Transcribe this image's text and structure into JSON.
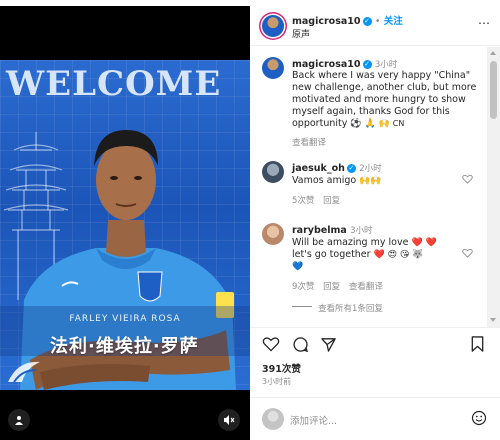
{
  "post": {
    "username": "magicrosa10",
    "follow_label": "关注",
    "audio_label": "原声",
    "separator": "•"
  },
  "media": {
    "banner_text": "WELCOME",
    "player_name": "FARLEY VIEIRA ROSA",
    "player_name_cn": "法利·维埃拉·罗萨",
    "user_icon": "person-icon",
    "mute_icon": "muted-speaker-icon"
  },
  "caption": {
    "username": "magicrosa10",
    "time": "3小时",
    "text": "Back where I was very happy \"China\" new challenge, another club, but more motivated and more hungry to show myself again, thanks God for this opportunity",
    "emojis": "⚽ 🙏 🙌",
    "emoji_tail": "CN",
    "translate_label": "查看翻译"
  },
  "comments": [
    {
      "username": "jaesuk_oh",
      "time": "2小时",
      "text": "Vamos amigo",
      "emojis": "🙌🙌",
      "likes": "5次赞",
      "reply": "回复"
    },
    {
      "username": "rarybelma",
      "time": "3小时",
      "text_line1": "Will be amazing my love",
      "emojis_line1": "❤️ ❤️",
      "text_line2": "let's go together",
      "emojis_line2": "❤️ 😍 😘 🐺",
      "emojis_line3": "💙",
      "likes": "9次赞",
      "reply": "回复",
      "translate_label": "查看翻译"
    }
  ],
  "view_replies_label": "查看所有1条回复",
  "actions": {
    "likes": "391次赞",
    "time": "3小时前"
  },
  "composer": {
    "placeholder": "添加评论..."
  },
  "colors": {
    "accent": "#0095f6",
    "text": "#262626",
    "muted": "#8e8e8e",
    "poster_blue": "#1c55b8",
    "jersey": "#3c9ae6"
  }
}
